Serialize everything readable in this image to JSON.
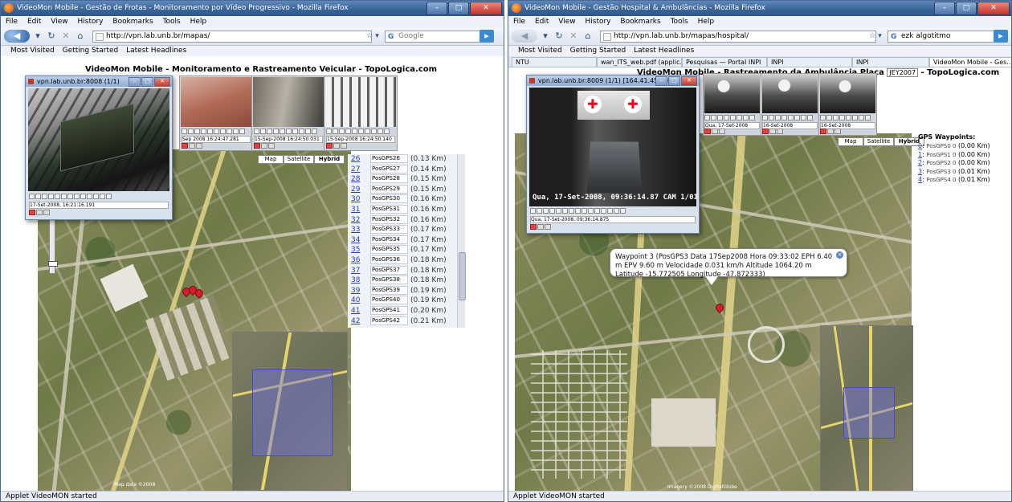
{
  "left": {
    "title": "VideoMon Mobile - Gestão de Frotas - Monitoramento por Vídeo Progressivo - Mozilla Firefox",
    "menu": [
      "File",
      "Edit",
      "View",
      "History",
      "Bookmarks",
      "Tools",
      "Help"
    ],
    "url": "http://vpn.lab.unb.br/mapas/",
    "search_placeholder": "Google",
    "bookmarks": [
      "Most Visited",
      "Getting Started",
      "Latest Headlines"
    ],
    "page_title": "VideoMon Mobile - Monitoramento e Rastreamento Veicular - TopoLogica.com",
    "applet_title": "vpn.lab.unb.br:8008  (1/1)",
    "applet_info": "17-Set-2008, 16:21:16.191",
    "map_buttons": [
      "Map",
      "Satellite",
      "Hybrid"
    ],
    "gps_items": [
      {
        "num": "26",
        "label": "PosGPS26",
        "dist": "(0.13 Km)"
      },
      {
        "num": "27",
        "label": "PosGPS27",
        "dist": "(0.14 Km)"
      },
      {
        "num": "28",
        "label": "PosGPS28",
        "dist": "(0.15 Km)"
      },
      {
        "num": "29",
        "label": "PosGPS29",
        "dist": "(0.15 Km)"
      },
      {
        "num": "30",
        "label": "PosGPS30",
        "dist": "(0.16 Km)"
      },
      {
        "num": "31",
        "label": "PosGPS31",
        "dist": "(0.16 Km)"
      },
      {
        "num": "32",
        "label": "PosGPS32",
        "dist": "(0.16 Km)"
      },
      {
        "num": "33",
        "label": "PosGPS33",
        "dist": "(0.17 Km)"
      },
      {
        "num": "34",
        "label": "PosGPS34",
        "dist": "(0.17 Km)"
      },
      {
        "num": "35",
        "label": "PosGPS35",
        "dist": "(0.17 Km)"
      },
      {
        "num": "36",
        "label": "PosGPS36",
        "dist": "(0.18 Km)"
      },
      {
        "num": "37",
        "label": "PosGPS37",
        "dist": "(0.18 Km)"
      },
      {
        "num": "38",
        "label": "PosGPS38",
        "dist": "(0.18 Km)"
      },
      {
        "num": "39",
        "label": "PosGPS39",
        "dist": "(0.19 Km)"
      },
      {
        "num": "40",
        "label": "PosGPS40",
        "dist": "(0.19 Km)"
      },
      {
        "num": "41",
        "label": "PosGPS41",
        "dist": "(0.20 Km)"
      },
      {
        "num": "42",
        "label": "PosGPS42",
        "dist": "(0.21 Km)"
      }
    ],
    "status": "Applet VideoMON started"
  },
  "right": {
    "title": "VideoMon Mobile - Gestão Hospital & Ambulâncias - Mozilla Firefox",
    "menu": [
      "File",
      "Edit",
      "View",
      "History",
      "Bookmarks",
      "Tools",
      "Help"
    ],
    "url": "http://vpn.lab.unb.br/mapas/hospital/",
    "search_value": "ezk algotitmo",
    "bookmarks": [
      "Most Visited",
      "Getting Started",
      "Latest Headlines"
    ],
    "tabs": [
      "NTU",
      "wan_ITS_web.pdf (applic...",
      "Pesquisas — Portal INPI",
      "INPI",
      "INPI",
      "VideoMon Mobile - Ges..."
    ],
    "page_title_prefix": "VideoMon Mobile - Rastreamento da Ambulância Placa",
    "plate": "JEY2007",
    "page_title_suffix": "- TopoLogica.com",
    "applet_title": "vpn.lab.unb.br:8009  (1/1)  [164.41.45.60]",
    "video_overlay": "Qua, 17-Set-2008, 09:36:14.87 CAM 1/01",
    "applet_info": "Qua, 17-Set-2008, 09:36:14.875",
    "map_buttons": [
      "Map",
      "Satellite",
      "Hybrid"
    ],
    "gps_header": "GPS Waypoints:",
    "gps_items": [
      {
        "num": "0",
        "label": "PosGPS0 0",
        "dist": "(0.00 Km)"
      },
      {
        "num": "1",
        "label": "PosGPS1 0",
        "dist": "(0.00 Km)"
      },
      {
        "num": "2",
        "label": "PosGPS2 0",
        "dist": "(0.00 Km)"
      },
      {
        "num": "3",
        "label": "PosGPS3 0",
        "dist": "(0.01 Km)"
      },
      {
        "num": "4",
        "label": "PosGPS4 0",
        "dist": "(0.01 Km)"
      }
    ],
    "popup_text": "Waypoint 3 (PosGPS3 Data 17Sep2008 Hora 09:33:02 EPH 6.40 m EPV 9.60 m Velocidade 0.031 km/h Altitude 1064.20 m Latitude -15.772505 Longitude -47.872333)",
    "status": "Applet VideoMON started"
  },
  "colors": {
    "titlebar": "#3b6699",
    "link": "#2a3fb0",
    "marker": "#d21f2c",
    "route": "#e2d48a"
  }
}
